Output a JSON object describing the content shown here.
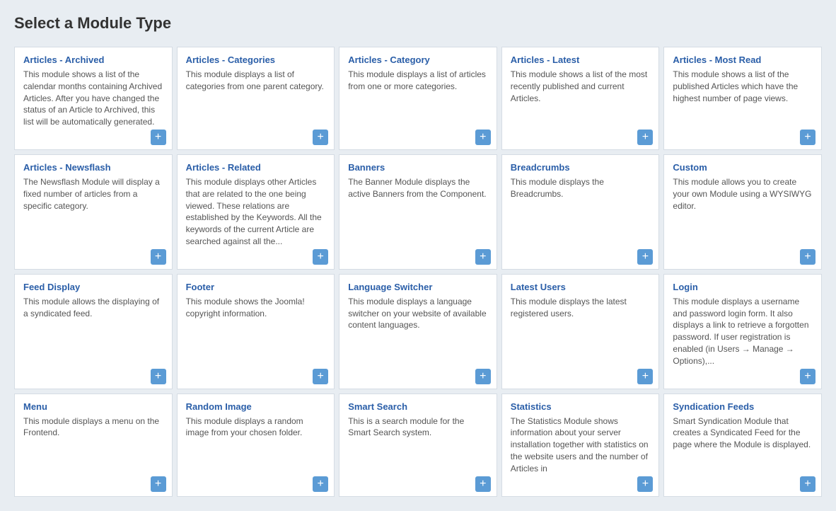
{
  "page": {
    "title": "Select a Module Type"
  },
  "modules": [
    {
      "id": "articles-archived",
      "title": "Articles - Archived",
      "description": "This module shows a list of the calendar months containing Archived Articles. After you have changed the status of an Article to Archived, this list will be automatically generated."
    },
    {
      "id": "articles-categories",
      "title": "Articles - Categories",
      "description": "This module displays a list of categories from one parent category."
    },
    {
      "id": "articles-category",
      "title": "Articles - Category",
      "description": "This module displays a list of articles from one or more categories."
    },
    {
      "id": "articles-latest",
      "title": "Articles - Latest",
      "description": "This module shows a list of the most recently published and current Articles."
    },
    {
      "id": "articles-most-read",
      "title": "Articles - Most Read",
      "description": "This module shows a list of the published Articles which have the highest number of page views."
    },
    {
      "id": "articles-newsflash",
      "title": "Articles - Newsflash",
      "description": "The Newsflash Module will display a fixed number of articles from a specific category."
    },
    {
      "id": "articles-related",
      "title": "Articles - Related",
      "description": "This module displays other Articles that are related to the one being viewed. These relations are established by the Keywords. All the keywords of the current Article are searched against all the..."
    },
    {
      "id": "banners",
      "title": "Banners",
      "description": "The Banner Module displays the active Banners from the Component."
    },
    {
      "id": "breadcrumbs",
      "title": "Breadcrumbs",
      "description": "This module displays the Breadcrumbs."
    },
    {
      "id": "custom",
      "title": "Custom",
      "description": "This module allows you to create your own Module using a WYSIWYG editor."
    },
    {
      "id": "feed-display",
      "title": "Feed Display",
      "description": "This module allows the displaying of a syndicated feed."
    },
    {
      "id": "footer",
      "title": "Footer",
      "description": "This module shows the Joomla! copyright information."
    },
    {
      "id": "language-switcher",
      "title": "Language Switcher",
      "description": "This module displays a language switcher on your website of available content languages."
    },
    {
      "id": "latest-users",
      "title": "Latest Users",
      "description": "This module displays the latest registered users."
    },
    {
      "id": "login",
      "title": "Login",
      "description": "This module displays a username and password login form. It also displays a link to retrieve a forgotten password. If user registration is enabled (in Users &rarr; Manage &rarr; Options),..."
    },
    {
      "id": "menu",
      "title": "Menu",
      "description": "This module displays a menu on the Frontend."
    },
    {
      "id": "random-image",
      "title": "Random Image",
      "description": "This module displays a random image from your chosen folder."
    },
    {
      "id": "smart-search",
      "title": "Smart Search",
      "description": "This is a search module for the Smart Search system."
    },
    {
      "id": "statistics",
      "title": "Statistics",
      "description": "The Statistics Module shows information about your server installation together with statistics on the website users and the number of Articles in"
    },
    {
      "id": "syndication-feeds",
      "title": "Syndication Feeds",
      "description": "Smart Syndication Module that creates a Syndicated Feed for the page where the Module is displayed."
    }
  ],
  "add_label": "+"
}
